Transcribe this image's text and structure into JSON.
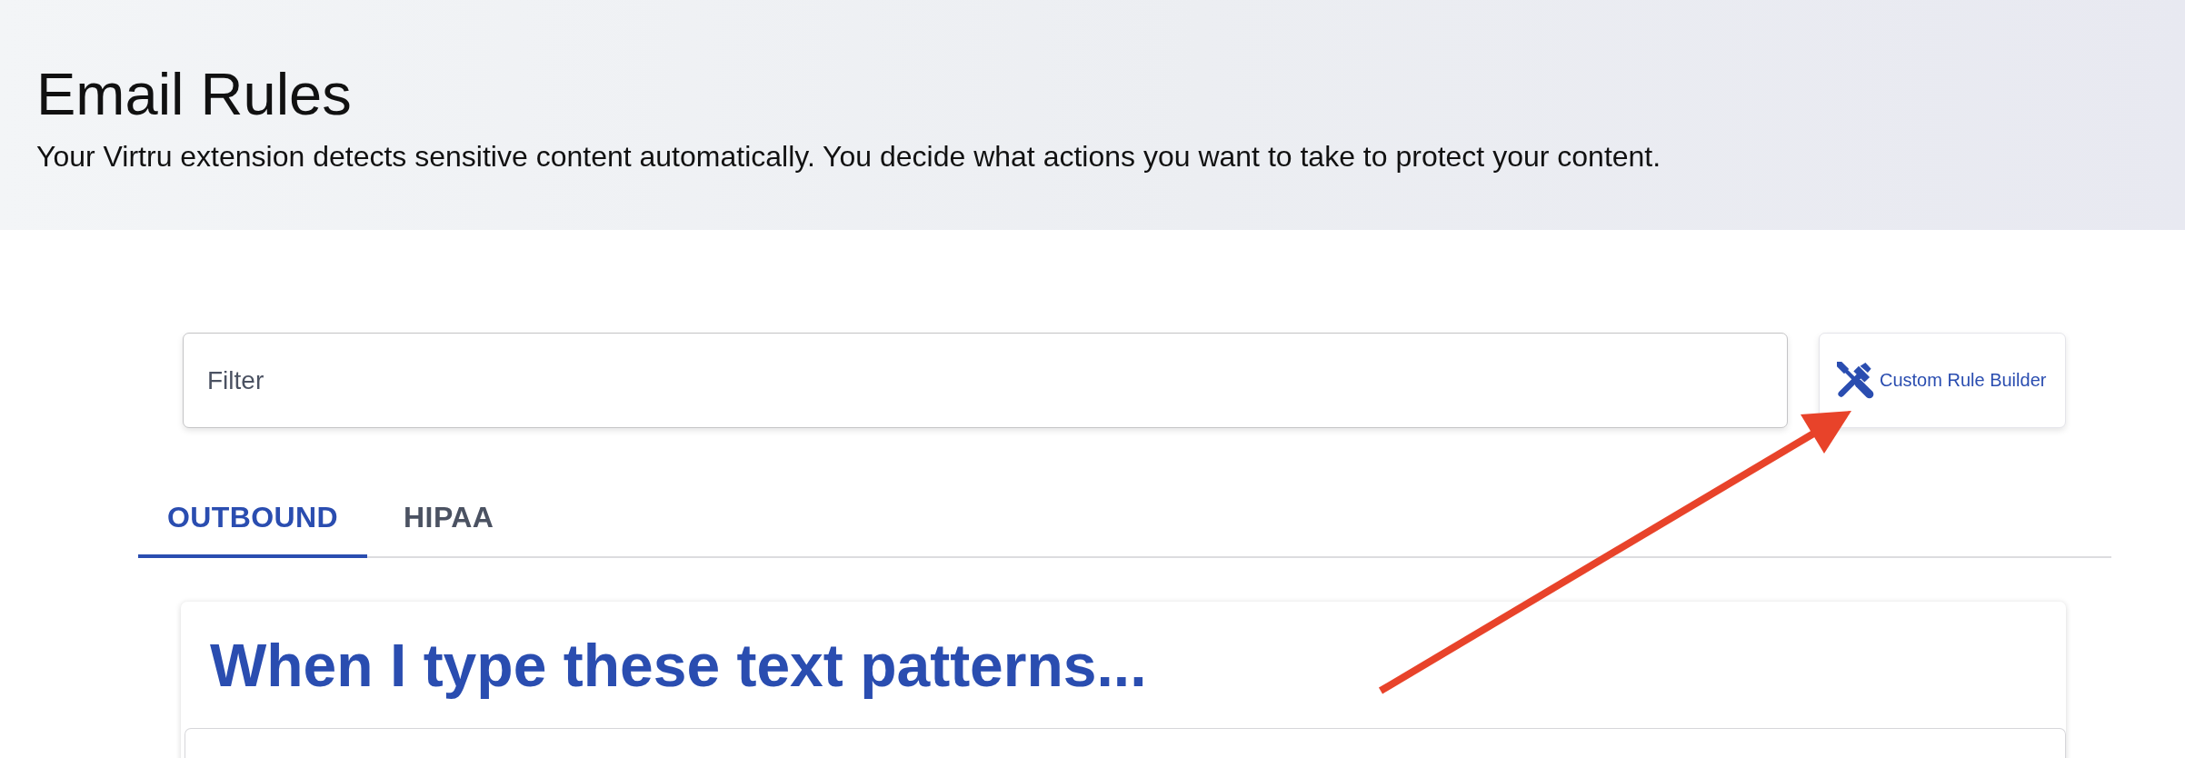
{
  "header": {
    "title": "Email Rules",
    "subtitle": "Your Virtru extension detects sensitive content automatically. You decide what actions you want to take to protect your content."
  },
  "filter": {
    "placeholder": "Filter"
  },
  "rule_builder_button": {
    "label": "Custom Rule Builder"
  },
  "tabs": [
    {
      "label": "OUTBOUND",
      "selected": true
    },
    {
      "label": "HIPAA",
      "selected": false
    }
  ],
  "card": {
    "title": "When I type these text patterns..."
  }
}
